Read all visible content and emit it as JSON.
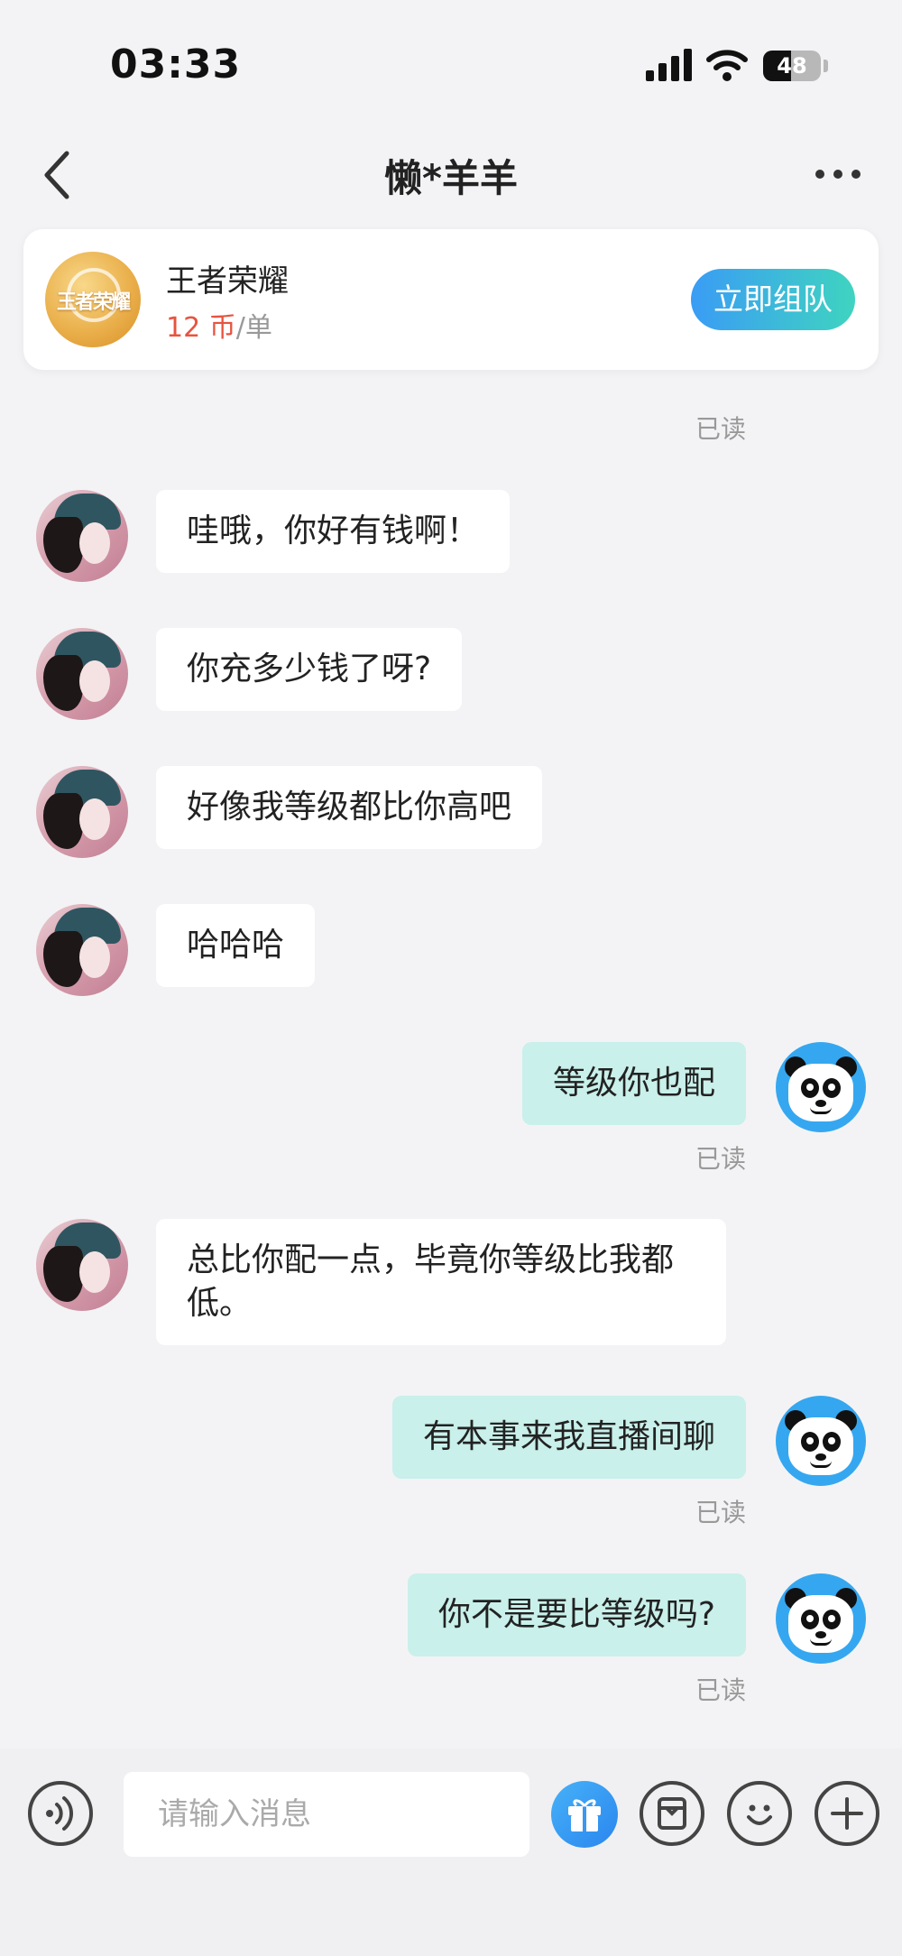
{
  "status_bar": {
    "time": "03:33",
    "battery": "48",
    "battery_level": 0.48
  },
  "nav": {
    "title": "懒*羊羊"
  },
  "game_card": {
    "logo_text": "王者荣耀",
    "name": "王者荣耀",
    "price": "12 币",
    "unit": "/单",
    "button": "立即组队"
  },
  "messages": [
    {
      "side": "left",
      "text": "哇哦，你好有钱啊！"
    },
    {
      "side": "left",
      "text": "你充多少钱了呀?"
    },
    {
      "side": "left",
      "text": "好像我等级都比你高吧"
    },
    {
      "side": "left",
      "text": "哈哈哈"
    },
    {
      "side": "right",
      "text": "等级你也配",
      "status": "已读"
    },
    {
      "side": "left",
      "text": "总比你配一点，毕竟你等级比我都低。"
    },
    {
      "side": "right",
      "text": "有本事来我直播间聊",
      "status": "已读"
    },
    {
      "side": "right",
      "text": "你不是要比等级吗?",
      "status": "已读"
    }
  ],
  "top_read_status": "已读",
  "input": {
    "placeholder": "请输入消息"
  }
}
